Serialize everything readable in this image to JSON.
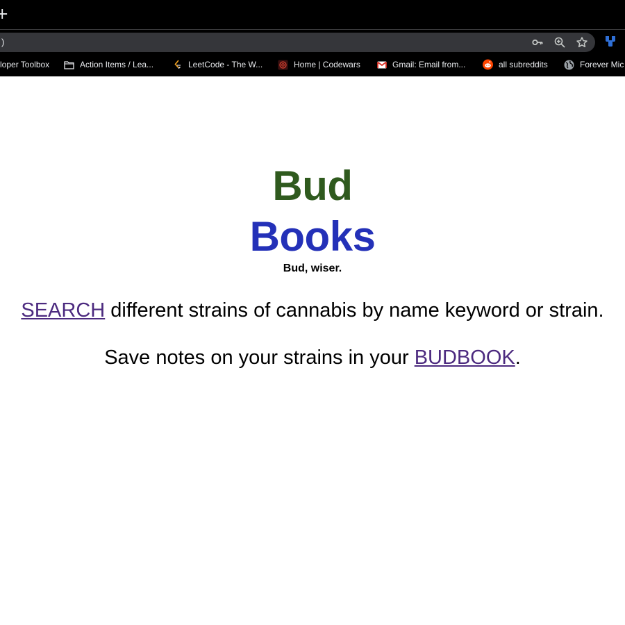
{
  "browser": {
    "new_tab_glyph": "+",
    "address_bar": {
      "url_fragment": ")",
      "icons": [
        "key-icon",
        "zoom-icon",
        "bookmark-star-icon"
      ]
    },
    "extension_icon": "extension-icon",
    "bookmarks": [
      {
        "label": "loper Toolbox",
        "icon": "none"
      },
      {
        "label": "Action Items / Lea...",
        "icon": "folder-icon"
      },
      {
        "label": "LeetCode - The W...",
        "icon": "leetcode-icon"
      },
      {
        "label": "Home | Codewars",
        "icon": "codewars-icon"
      },
      {
        "label": "Gmail: Email from...",
        "icon": "gmail-icon"
      },
      {
        "label": "all subreddits",
        "icon": "reddit-icon"
      },
      {
        "label": "Forever Mic",
        "icon": "globe-icon"
      }
    ]
  },
  "page": {
    "title_line1": "Bud",
    "title_line2": "Books",
    "tagline": "Bud, wiser.",
    "search_link": "SEARCH",
    "search_text": " different strains of cannabis by name keyword or strain.",
    "notes_text": "Save notes on your strains in your ",
    "budbook_link": "BUDBOOK",
    "notes_end": "."
  },
  "colors": {
    "title_bud": "#2f5a1e",
    "title_books": "#2431b8",
    "link": "#4c2a7f",
    "chrome_bg": "#000000",
    "omnibox_bg": "#35363a"
  }
}
